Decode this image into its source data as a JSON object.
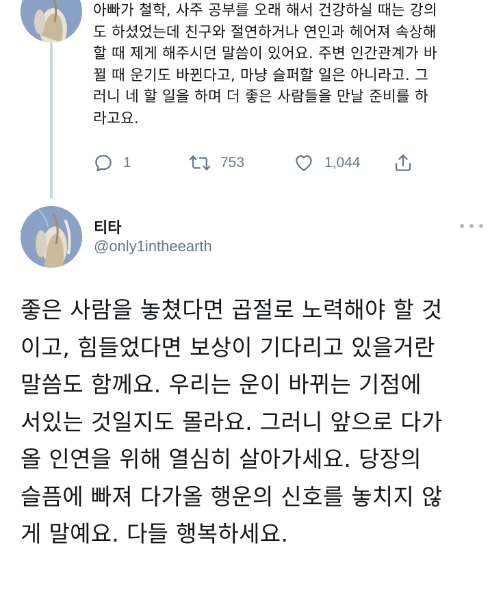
{
  "previous_tweet": {
    "avatar_icon": "profile-photo",
    "text": "아빠가 철학, 사주 공부를 오래 해서 건강하실 때는 강의\n도 하셨었는데 친구와 절연하거나 연인과 헤어져 속상해\n할 때 제게 해주시던 말씀이 있어요. 주변 인간관계가 바\n뀔 때 운기도 바뀐다고, 마냥 슬퍼할 일은 아니라고. 그\n러니 네 할 일을 하며 더 좋은 사람들을 만날 준비를 하\n라고요.",
    "actions": {
      "reply_count": "1",
      "retweet_count": "753",
      "like_count": "1,044"
    }
  },
  "tweet": {
    "author_name": "티타",
    "author_handle": "@only1intheearth",
    "text": "좋은 사람을 놓쳤다면 곱절로 노력해야 할 것\n이고, 힘들었다면 보상이 기다리고 있을거란\n말씀도 함께요. 우리는 운이 바뀌는 기점에\n서있는 것일지도 몰라요. 그러니 앞으로 다가\n올 인연을 위해 열심히 살아가세요. 당장의\n슬픔에 빠져 다가올 행운의 신호를 놓치지 않\n게 말예요. 다들 행복하세요."
  },
  "colors": {
    "text": "#14171a",
    "muted": "#657786",
    "thread_line": "#ccd6dd"
  }
}
